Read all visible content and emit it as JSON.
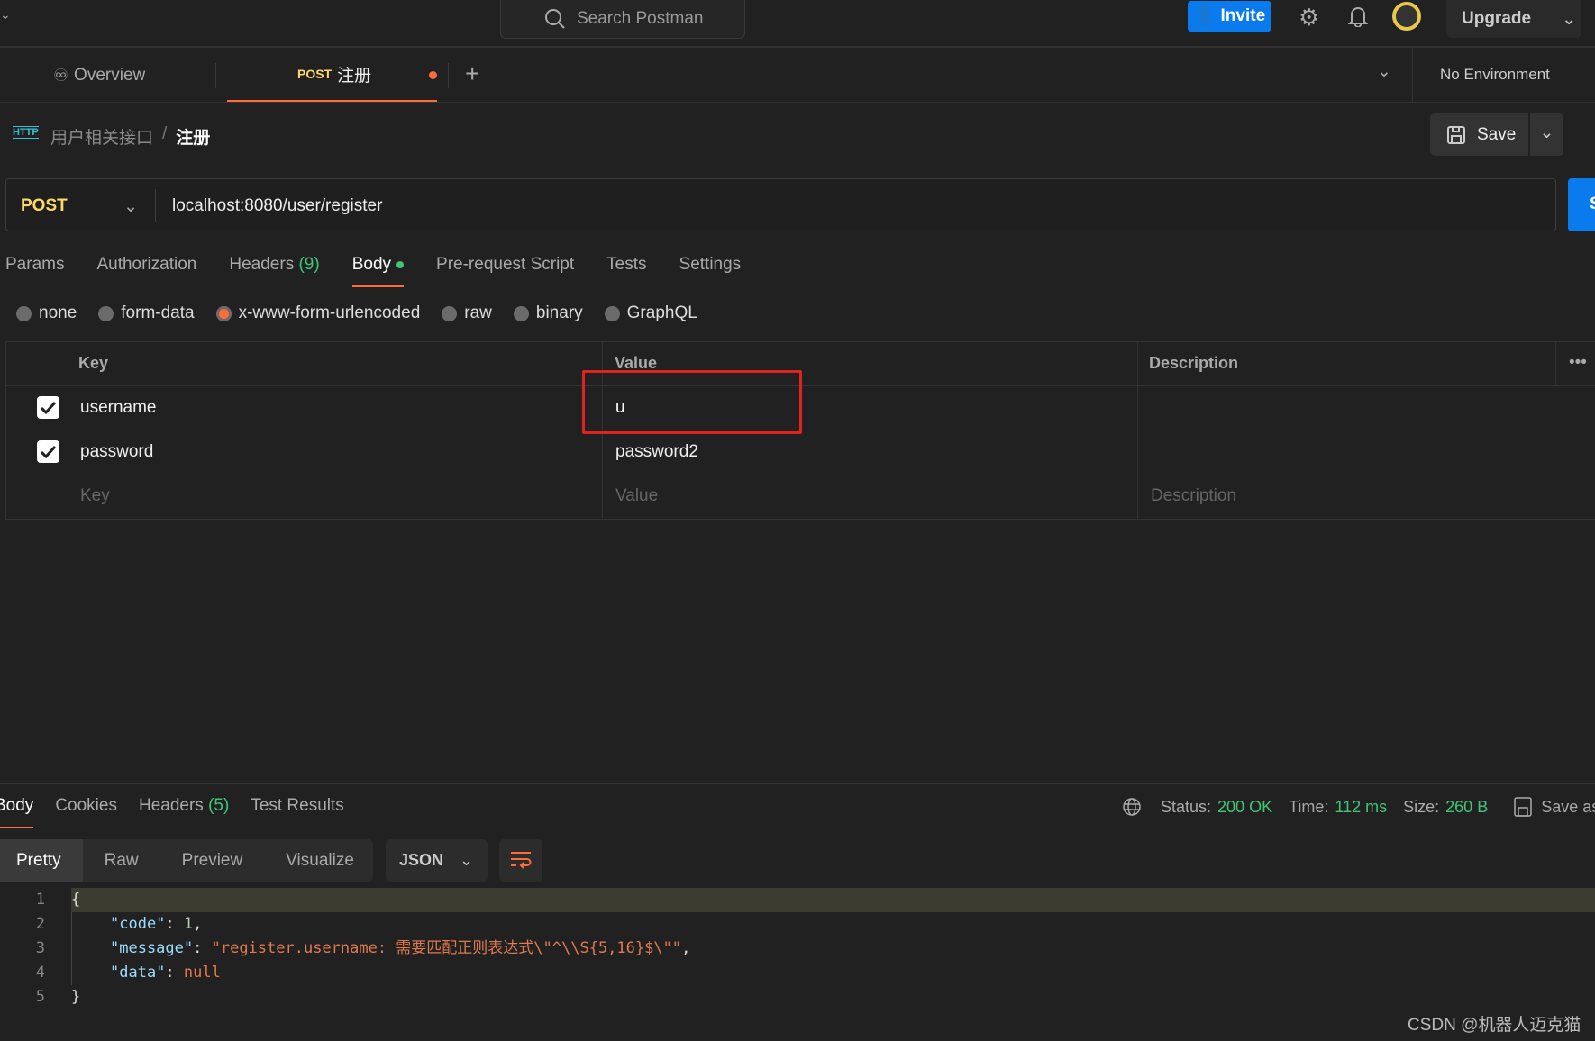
{
  "topbar": {
    "search_placeholder": "Search Postman",
    "invite": "Invite",
    "upgrade": "Upgrade"
  },
  "tabs": {
    "overview": "Overview",
    "active_method": "POST",
    "active_name": "注册",
    "environment": "No Environment"
  },
  "breadcrumb": {
    "collection": "用户相关接口",
    "separator": "/",
    "request": "注册",
    "save": "Save"
  },
  "request": {
    "method": "POST",
    "url": "localhost:8080/user/register",
    "send": "S"
  },
  "request_tabs": [
    {
      "label": "Params"
    },
    {
      "label": "Authorization"
    },
    {
      "label": "Headers",
      "count": "(9)"
    },
    {
      "label": "Body"
    },
    {
      "label": "Pre-request Script"
    },
    {
      "label": "Tests"
    },
    {
      "label": "Settings"
    }
  ],
  "body_types": [
    {
      "label": "none"
    },
    {
      "label": "form-data"
    },
    {
      "label": "x-www-form-urlencoded",
      "selected": true
    },
    {
      "label": "raw"
    },
    {
      "label": "binary"
    },
    {
      "label": "GraphQL"
    }
  ],
  "table": {
    "headers": [
      "Key",
      "Value",
      "Description"
    ],
    "rows": [
      {
        "checked": true,
        "key": "username",
        "value": "u",
        "description": ""
      },
      {
        "checked": true,
        "key": "password",
        "value": "password2",
        "description": ""
      }
    ],
    "placeholder": {
      "key": "Key",
      "value": "Value",
      "description": "Description"
    }
  },
  "response": {
    "tabs": [
      {
        "label": "Body"
      },
      {
        "label": "Cookies"
      },
      {
        "label": "Headers",
        "count": "(5)"
      },
      {
        "label": "Test Results"
      }
    ],
    "status_label": "Status:",
    "status": "200 OK",
    "time_label": "Time:",
    "time": "112 ms",
    "size_label": "Size:",
    "size": "260 B",
    "save_as": "Save as",
    "views": [
      "Pretty",
      "Raw",
      "Preview",
      "Visualize"
    ],
    "format": "JSON",
    "code": {
      "line_numbers": [
        "1",
        "2",
        "3",
        "4",
        "5"
      ],
      "open": "{",
      "close": "}",
      "k1": "\"code\"",
      "v1": "1",
      "k2": "\"message\"",
      "v2": "\"register.username: 需要匹配正则表达式\\\"^\\\\S{5,16}$\\\"\"",
      "k3": "\"data\"",
      "v3": "null"
    }
  },
  "watermark": "CSDN @机器人迈克猫",
  "colors": {
    "accent": "#ff6c37",
    "method": "#ffd966",
    "blue": "#097bed",
    "green": "#3fc777",
    "highlight_box": "#e0231f"
  }
}
